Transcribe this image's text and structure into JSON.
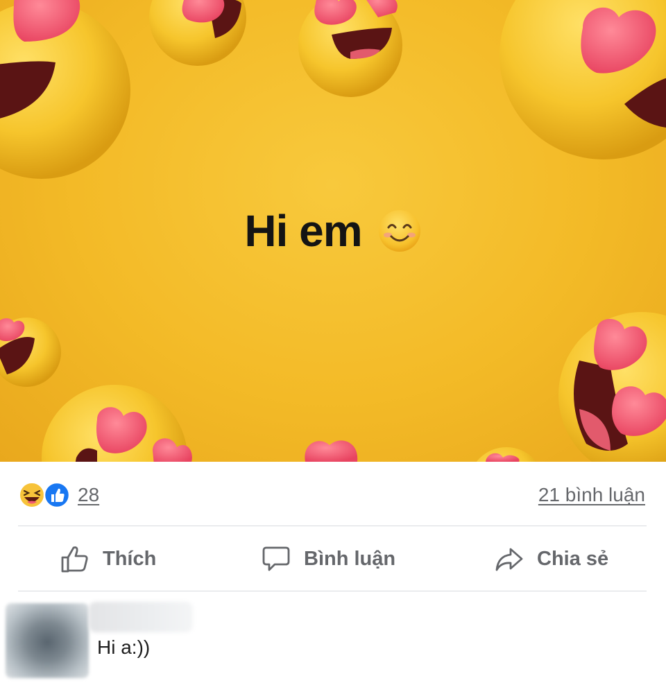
{
  "post": {
    "text": "Hi em",
    "emoji_icon": "smiling-face-icon",
    "background_color": "#f3ba27"
  },
  "reactions": {
    "icons": [
      "laughing-emoji-icon",
      "like-thumb-icon"
    ],
    "count": "28",
    "comments_link": "21 bình luận"
  },
  "actions": {
    "like_label": "Thích",
    "comment_label": "Bình luận",
    "share_label": "Chia sẻ"
  },
  "comments": [
    {
      "author": "",
      "text": "Hi a:))"
    }
  ],
  "colors": {
    "muted_text": "#65676b",
    "like_blue": "#1877f2",
    "heart_pink": "#f25a72",
    "emoji_yellow": "#f9cc35"
  }
}
